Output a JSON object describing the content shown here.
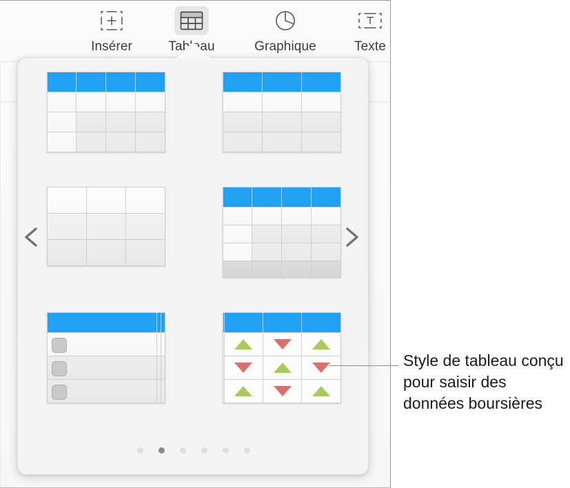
{
  "window": {
    "toolbar": {
      "items": [
        {
          "label": "Insérer",
          "icon": "insert-media-icon",
          "selected": false
        },
        {
          "label": "Tableau",
          "icon": "table-icon",
          "selected": true
        },
        {
          "label": "Graphique",
          "icon": "pie-chart-icon",
          "selected": false
        },
        {
          "label": "Texte",
          "icon": "text-box-icon",
          "selected": false
        }
      ]
    }
  },
  "popover": {
    "name": "table-style-picker",
    "prev_label": "chevron-left-icon",
    "next_label": "chevron-right-icon",
    "pager": {
      "total": 6,
      "active_index": 1
    },
    "styles": [
      {
        "name": "table-style-basic-4col",
        "columns": 4,
        "header": true,
        "header_color": "#1fa2f3",
        "body_rows": 3,
        "row_shading": [
          "light",
          "light",
          "alt",
          "alt"
        ],
        "column_separator_after": 1,
        "footer": false,
        "checkbox_column": false,
        "stock_arrows": false
      },
      {
        "name": "table-style-basic-3col",
        "columns": 3,
        "header": true,
        "header_color": "#1fa2f3",
        "body_rows": 3,
        "row_shading": [
          "light",
          "alt",
          "alt"
        ],
        "column_separator_after": 0,
        "footer": false,
        "checkbox_column": false,
        "stock_arrows": false
      },
      {
        "name": "table-style-plain-3x3",
        "columns": 3,
        "header": false,
        "header_color": "",
        "body_rows": 3,
        "row_shading": [
          "plain1",
          "plain2",
          "plain3"
        ],
        "column_separator_after": 0,
        "footer": false,
        "checkbox_column": false,
        "stock_arrows": false
      },
      {
        "name": "table-style-with-footer",
        "columns": 4,
        "header": true,
        "header_color": "#1fa2f3",
        "body_rows": 3,
        "row_shading": [
          "light",
          "alt",
          "alt"
        ],
        "column_separator_after": 1,
        "footer": true,
        "checkbox_column": false,
        "stock_arrows": false
      },
      {
        "name": "table-style-checklist",
        "columns": 3,
        "header": true,
        "header_color": "#1fa2f3",
        "body_rows": 3,
        "row_shading": [
          "light",
          "alt",
          "alt"
        ],
        "column_separator_after": 0,
        "footer": false,
        "checkbox_column": true,
        "stock_arrows": false
      },
      {
        "name": "table-style-stock",
        "columns": 4,
        "header": true,
        "header_color": "#1fa2f3",
        "body_rows": 3,
        "row_shading": [
          "light",
          "light",
          "light"
        ],
        "column_separator_after": 1,
        "footer": false,
        "checkbox_column": false,
        "stock_arrows": true,
        "arrow_grid": [
          [
            "",
            "up",
            "down",
            "up"
          ],
          [
            "",
            "down",
            "up",
            "down"
          ],
          [
            "",
            "up",
            "down",
            "up"
          ]
        ],
        "arrow_up_color": "#a8cc5c",
        "arrow_down_color": "#d9706b"
      }
    ]
  },
  "callout": {
    "text": "Style de tableau conçu pour saisir des données boursières"
  }
}
